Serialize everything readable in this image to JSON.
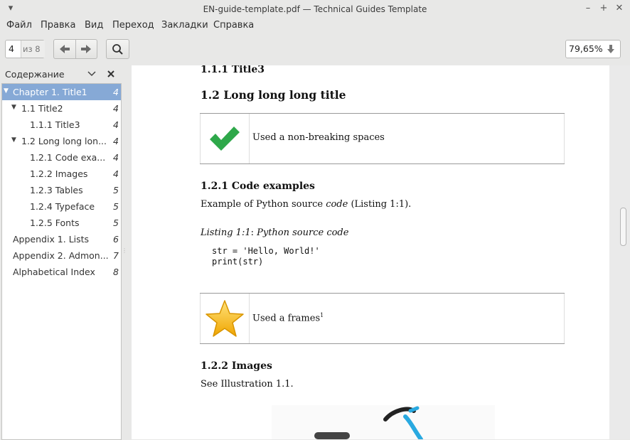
{
  "window": {
    "title": "EN-guide-template.pdf — Technical Guides Template",
    "controls": {
      "minimize": "–",
      "maximize": "+",
      "close": "✕"
    }
  },
  "menu": [
    "Файл",
    "Правка",
    "Вид",
    "Переход",
    "Закладки",
    "Справка"
  ],
  "toolbar": {
    "page_value": "4",
    "page_total": "из 8",
    "zoom": "79,65%"
  },
  "sidebar": {
    "title": "Содержание",
    "items": [
      {
        "label": "Chapter 1.  Title1",
        "page": "4"
      },
      {
        "label": "1.1  Title2",
        "page": "4"
      },
      {
        "label": "1.1.1  Title3",
        "page": "4"
      },
      {
        "label": "1.2  Long long lon...",
        "page": "4"
      },
      {
        "label": "1.2.1  Code exa...",
        "page": "4"
      },
      {
        "label": "1.2.2  Images",
        "page": "4"
      },
      {
        "label": "1.2.3  Tables",
        "page": "5"
      },
      {
        "label": "1.2.4  Typeface",
        "page": "5"
      },
      {
        "label": "1.2.5  Fonts",
        "page": "5"
      },
      {
        "label": "Appendix 1.  Lists",
        "page": "6"
      },
      {
        "label": "Appendix 2.  Admon...",
        "page": "7"
      },
      {
        "label": "Alphabetical Index",
        "page": "8"
      }
    ]
  },
  "document": {
    "h_title3": "1.1.1 Title3",
    "h_long": "1.2 Long long long title",
    "note1": "Used a non-breaking spaces",
    "h_code": "1.2.1 Code examples",
    "code_intro_pre": "Example of Python source ",
    "code_intro_em": "code",
    "code_intro_post": " (Listing 1:1).",
    "listing_caption_em1": "Listing 1:1",
    "listing_caption_sep": ": ",
    "listing_caption_em2": "Python source code",
    "code_line1": "str = 'Hello, World!'",
    "code_line2": "print(str)",
    "note2": "Used a frames",
    "note2_sup": "1",
    "h_images": "1.2.2 Images",
    "images_text": "See Illustration 1.1."
  }
}
